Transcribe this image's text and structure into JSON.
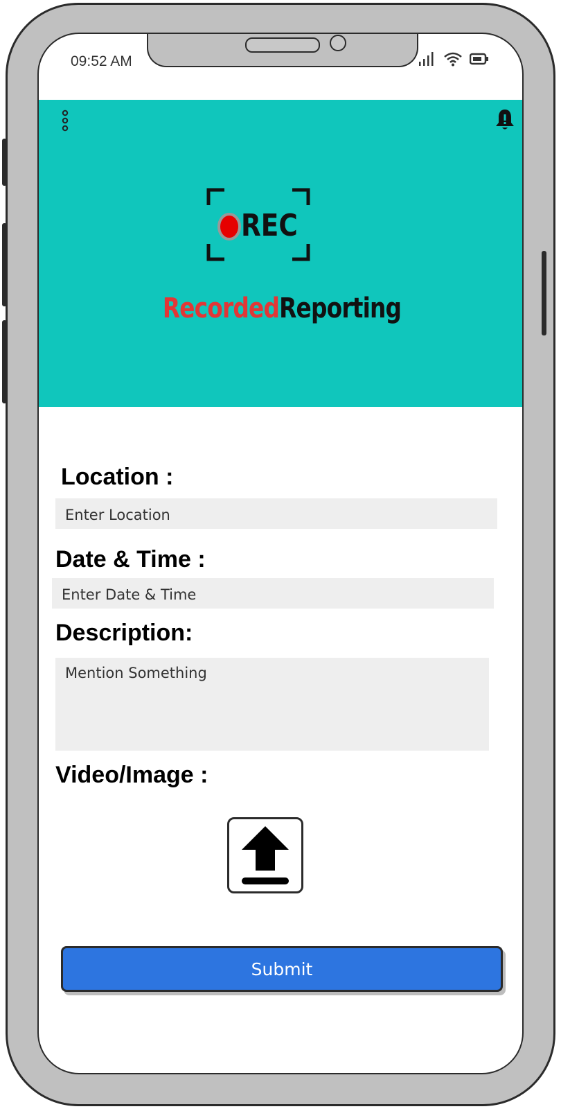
{
  "status_bar": {
    "time": "09:52 AM"
  },
  "app": {
    "logo_text": "REC",
    "brand_part1": "Recorded",
    "brand_part2": "Reporting"
  },
  "form": {
    "location_label": "Location :",
    "location_placeholder": "Enter Location",
    "datetime_label": "Date & Time :",
    "datetime_placeholder": "Enter Date & Time",
    "description_label": "Description:",
    "description_placeholder": "Mention Something",
    "media_label": "Video/Image :",
    "submit_label": "Submit"
  },
  "icons": {
    "menu": "more-vertical-icon",
    "notification": "bell-alert-icon",
    "upload": "upload-icon"
  },
  "colors": {
    "banner": "#10c6bc",
    "submit": "#2d75e0",
    "brand_red": "#e23636",
    "field_bg": "#eeeeee"
  }
}
